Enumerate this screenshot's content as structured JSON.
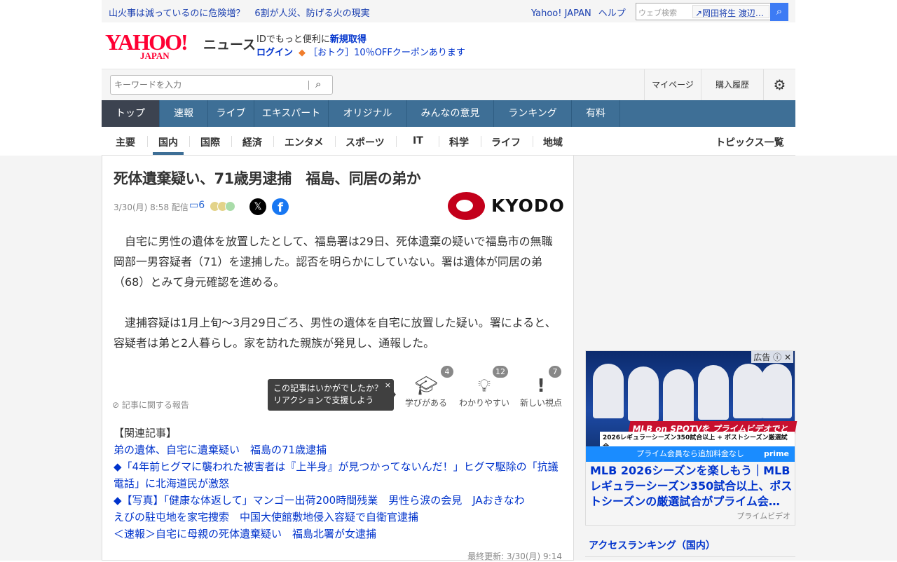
{
  "topbar": {
    "headlines": [
      "山火事は減っているのに危険増？",
      "6割が人災、防げる火の現実"
    ],
    "links": [
      "Yahoo! JAPAN",
      "ヘルプ"
    ],
    "search_placeholder": "ウェブ検索",
    "search_suggestion": "↗岡田将生 渡辺…",
    "search_icon": "search-icon"
  },
  "header": {
    "logo": "YAHOO! JAPAN",
    "logo_main": "YAHOO!",
    "logo_sub": "JAPAN",
    "service": "ニュース",
    "id_prefix": "IDでもっと便利に",
    "id_signup": "新規取得",
    "login": "ログイン",
    "coupon": "［おトク］10％OFFクーポンあります"
  },
  "toolbar": {
    "keyword_placeholder": "キーワードを入力",
    "mypage": "マイページ",
    "history": "購入履歴"
  },
  "nav": [
    "トップ",
    "速報",
    "ライブ",
    "エキスパート",
    "オリジナル",
    "みんなの意見",
    "ランキング",
    "有料"
  ],
  "subnav": {
    "items": [
      "主要",
      "国内",
      "国際",
      "経済",
      "エンタメ",
      "スポーツ",
      "IT",
      "科学",
      "ライフ",
      "地域"
    ],
    "topics": "トピックス一覧",
    "active": "国内"
  },
  "article": {
    "title": "死体遺棄疑い、71歳男逮捕　福島、同居の弟か",
    "date": "3/30(月) 8:58 配信",
    "comments": "6",
    "source": "KYODO",
    "paragraphs": [
      "自宅に男性の遺体を放置したとして、福島署は29日、死体遺棄の疑いで福島市の無職岡部一男容疑者（71）を逮捕した。認否を明らかにしていない。署は遺体が同居の弟（68）とみて身元確認を進める。",
      "逮捕容疑は1月上旬～3月29日ごろ、男性の遺体を自宅に放置した疑い。署によると、容疑者は弟と2人暮らし。家を訪れた親族が発見し、通報した。"
    ],
    "report": "記事に関する報告",
    "tooltip": [
      "この記事はいかがでしたか？",
      "リアクションで支援しよう"
    ],
    "reactions": [
      {
        "label": "学びがある",
        "count": "4"
      },
      {
        "label": "わかりやすい",
        "count": "12"
      },
      {
        "label": "新しい視点",
        "count": "7"
      }
    ],
    "related_heading": "【関連記事】",
    "related": [
      "弟の遺体、自宅に遺棄疑い　福島の71歳逮捕",
      "◆「4年前ヒグマに襲われた被害者は『上半身』が見つかってないんだ！」ヒグマ駆除の「抗議電話」に北海道民が激怒",
      "◆【写真】「健康な体返して」マンゴー出荷200時間残業　男性ら涙の会見　JAおきなわ",
      "えびの駐屯地を家宅捜索　中国大使館敷地侵入容疑で自衛官逮捕",
      "＜速報＞自宅に母親の死体遺棄疑い　福島北署が女逮捕"
    ],
    "updated": "最終更新: 3/30(月) 9:14"
  },
  "ad": {
    "label": "広告",
    "headline": "MLB on SPOTVを プライムビデオでとことん観よう!",
    "sub": "2026レギュラーシーズン350試合以上 + ポストシーズン厳選試合",
    "banner": "プライム会員なら追加料金なし",
    "brand": "prime",
    "title": "MLB 2026シーズンを楽しもう｜MLBレギュラーシーズン350試合以上、ポストシーズンの厳選試合がプライム会…",
    "source": "プライムビデオ"
  },
  "sidebar": {
    "ranking_title": "アクセスランキング（国内）"
  }
}
